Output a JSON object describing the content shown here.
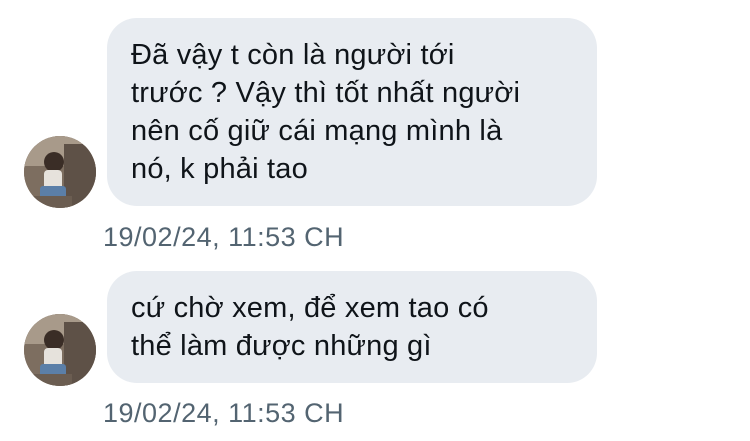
{
  "messages": [
    {
      "lines": [
        "Đã vậy t còn là người tới",
        "trước ? Vậy thì tốt nhất người",
        "nên cố giữ cái mạng mình là",
        "nó, k phải tao"
      ],
      "timestamp": "19/02/24, 11:53 CH",
      "avatar_icon": "user-avatar-photo"
    },
    {
      "lines": [
        "cứ chờ xem, để xem tao có",
        "thể làm được những gì"
      ],
      "timestamp": "19/02/24, 11:53 CH",
      "avatar_icon": "user-avatar-photo"
    }
  ],
  "colors": {
    "bubble_bg": "#e8ecf1",
    "text": "#0f1419",
    "timestamp": "#536471"
  }
}
